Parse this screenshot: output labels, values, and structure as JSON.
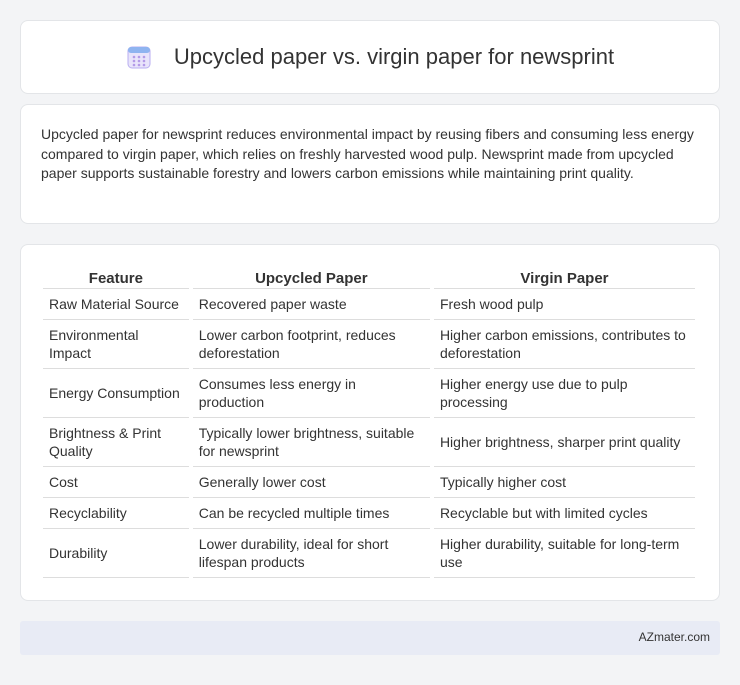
{
  "header": {
    "title": "Upcycled paper vs. virgin paper for newsprint",
    "icon": "calendar-icon",
    "icon_color": "#9b8ee6"
  },
  "intro": {
    "text": "Upcycled paper for newsprint reduces environmental impact by reusing fibers and consuming less energy compared to virgin paper, which relies on freshly harvested wood pulp. Newsprint made from upcycled paper supports sustainable forestry and lowers carbon emissions while maintaining print quality."
  },
  "table": {
    "headers": [
      "Feature",
      "Upcycled Paper",
      "Virgin Paper"
    ],
    "rows": [
      [
        "Raw Material Source",
        "Recovered paper waste",
        "Fresh wood pulp"
      ],
      [
        "Environmental Impact",
        "Lower carbon footprint, reduces deforestation",
        "Higher carbon emissions, contributes to deforestation"
      ],
      [
        "Energy Consumption",
        "Consumes less energy in production",
        "Higher energy use due to pulp processing"
      ],
      [
        "Brightness & Print Quality",
        "Typically lower brightness, suitable for newsprint",
        "Higher brightness, sharper print quality"
      ],
      [
        "Cost",
        "Generally lower cost",
        "Typically higher cost"
      ],
      [
        "Recyclability",
        "Can be recycled multiple times",
        "Recyclable but with limited cycles"
      ],
      [
        "Durability",
        "Lower durability, ideal for short lifespan products",
        "Higher durability, suitable for long-term use"
      ]
    ]
  },
  "footer": {
    "site": "AZmater.com"
  }
}
